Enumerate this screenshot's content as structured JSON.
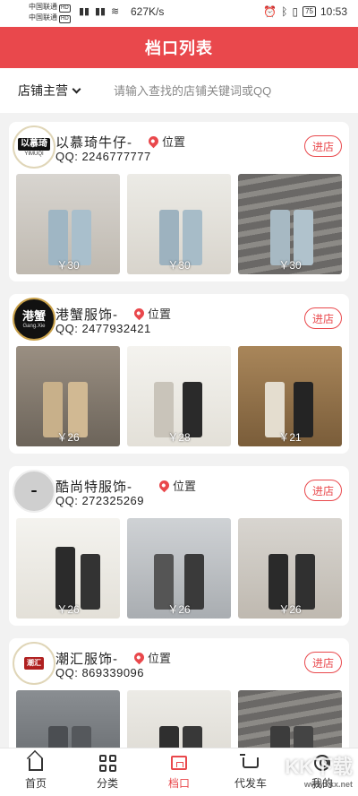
{
  "status_bar": {
    "carrier1": "中国联通",
    "carrier2": "中国联通",
    "hd": "HD",
    "net_speed": "627K/s",
    "battery": "75",
    "time": "10:53"
  },
  "header": {
    "title": "档口列表"
  },
  "search": {
    "filter_label": "店铺主营",
    "placeholder": "请输入查找的店铺关键词或QQ"
  },
  "shops": [
    {
      "name": "以慕琦牛仔-",
      "logo_text": "以慕琦",
      "logo_sub": "YIMUQI",
      "location": "位置",
      "qq": "QQ:  2246777777",
      "enter_label": "进店",
      "items": [
        {
          "price": "￥30"
        },
        {
          "price": "￥30"
        },
        {
          "price": "￥30"
        }
      ]
    },
    {
      "name": "港蟹服饰-",
      "logo_text": "港蟹",
      "logo_sub": "Gang.Xie",
      "location": "位置",
      "qq": "QQ:  2477932421",
      "enter_label": "进店",
      "items": [
        {
          "price": "￥26"
        },
        {
          "price": "￥28"
        },
        {
          "price": "￥21"
        }
      ]
    },
    {
      "name": "酷尚特服饰-",
      "logo_text": "",
      "logo_sub": "",
      "location": "位置",
      "qq": "QQ:  272325269",
      "enter_label": "进店",
      "items": [
        {
          "price": "￥26"
        },
        {
          "price": "￥26"
        },
        {
          "price": "￥26"
        }
      ]
    },
    {
      "name": "潮汇服饰-",
      "logo_text": "潮汇",
      "logo_sub": "",
      "location": "位置",
      "qq": "QQ:  869339096",
      "enter_label": "进店",
      "items": [
        {
          "price": ""
        },
        {
          "price": ""
        },
        {
          "price": ""
        }
      ]
    }
  ],
  "bottom_nav": [
    {
      "label": "首页",
      "icon": "home-icon"
    },
    {
      "label": "分类",
      "icon": "grid-icon"
    },
    {
      "label": "档口",
      "icon": "store-icon",
      "active": true
    },
    {
      "label": "代发车",
      "icon": "cart-icon"
    },
    {
      "label": "我的",
      "icon": "user-icon"
    }
  ],
  "watermark": {
    "text": "KK下载",
    "sub": "www.kkx.net"
  },
  "colors": {
    "accent": "#e9484c"
  }
}
